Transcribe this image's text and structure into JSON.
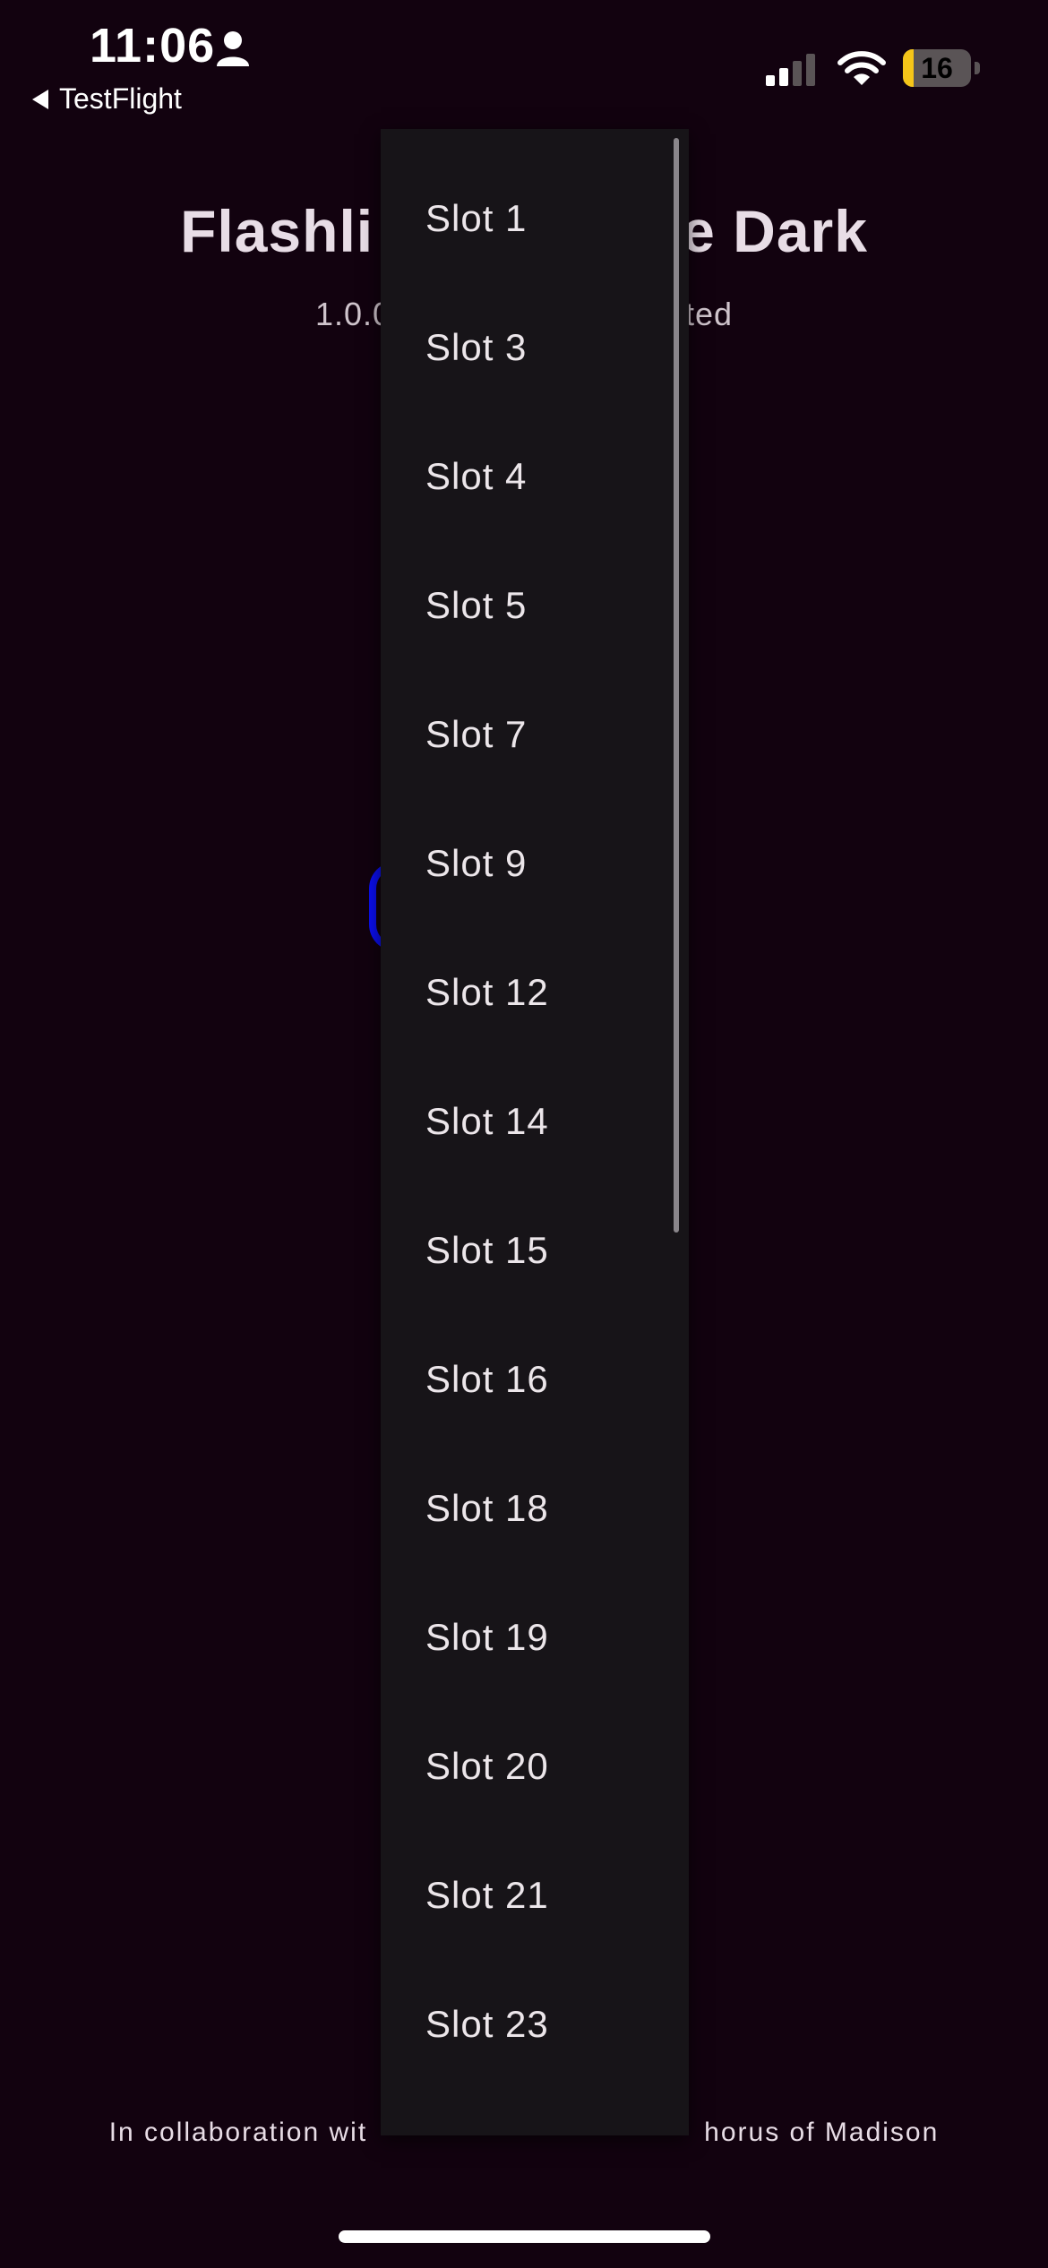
{
  "status_bar": {
    "time": "11:06",
    "back_label": "TestFlight",
    "battery_level": "16",
    "battery_fraction": 0.16,
    "battery_color": "#f5c519",
    "icons": [
      "person-icon",
      "back-arrow-icon",
      "signal-icon",
      "wifi-icon",
      "battery-icon"
    ]
  },
  "app": {
    "title": "Flashli",
    "title_end": "e Dark",
    "version": "1.0.0",
    "version_end": "ted",
    "footer_start": "In collaboration wit",
    "footer_end": "horus of Madison"
  },
  "dropdown": {
    "items": [
      "Slot 1",
      "Slot 3",
      "Slot 4",
      "Slot 5",
      "Slot 7",
      "Slot 9",
      "Slot 12",
      "Slot 14",
      "Slot 15",
      "Slot 16",
      "Slot 18",
      "Slot 19",
      "Slot 20",
      "Slot 21",
      "Slot 23"
    ]
  },
  "colors": {
    "background": "#12020f",
    "dropdown_bg": "#171418",
    "accent_blue": "#0b0ef0"
  }
}
